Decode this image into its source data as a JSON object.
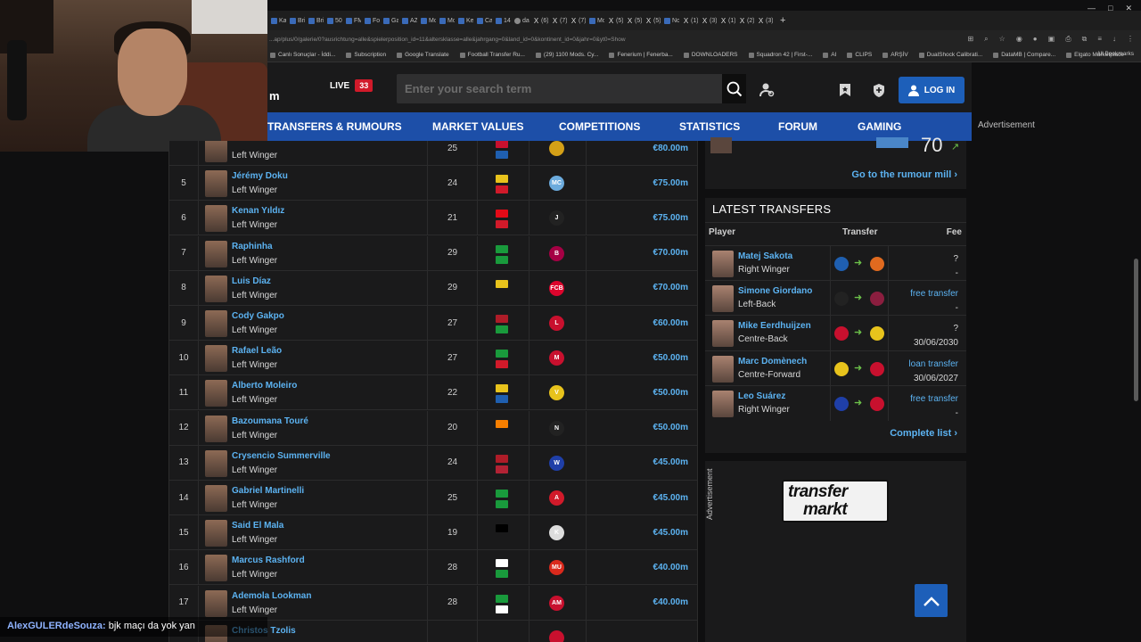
{
  "browser": {
    "tabs": [
      "Ka",
      "Bri",
      "Bri",
      "50",
      "FM",
      "Fo",
      "Gal",
      "AZ",
      "Mc",
      "Mc",
      "Ke",
      "Ca",
      "14",
      "da",
      "(6)",
      "(7)",
      "(7)",
      "Mc",
      "(5)",
      "(5)",
      "(5)",
      "No",
      "(1)",
      "(3)",
      "(1)",
      "(2)",
      "(3)"
    ],
    "url": "...ap/plus/0/galerie/0?ausrichtung=alle&spielerposition_id=11&altersklasse=alle&jahrgang=0&land_id=0&kontinent_id=0&jahr=0&yt0=Show",
    "bookmarks": [
      "Canlı Sonuçlar - İddi...",
      "Subscription",
      "Google Translate",
      "Football Transfer Ru...",
      "(29) 1100 Mods. Cy...",
      "Fenerium | Fenerba...",
      "DOWNLOADERS",
      "Squadron 42 | First-...",
      "AI",
      "CLIPS",
      "ARŞİV",
      "DualShock Calibrati...",
      "DataMB | Compare...",
      "Elgato Marketplace"
    ],
    "all_bookmarks": "All Bookmarks"
  },
  "header": {
    "logo_fragment": "m",
    "live_label": "LIVE",
    "live_count": "33",
    "search_placeholder": "Enter your search term",
    "login_label": "LOG IN"
  },
  "nav": [
    "TRANSFERS & RUMOURS",
    "MARKET VALUES",
    "COMPETITIONS",
    "STATISTICS",
    "FORUM",
    "GAMING"
  ],
  "advertisement": "Advertisement",
  "players": [
    {
      "rank": "",
      "name": "",
      "position": "Left Winger",
      "age": "25",
      "flags": [
        "#c8102e",
        "#1f5fb0"
      ],
      "club_color": "#d4a017",
      "club_abbr": "",
      "value": "€80.00m"
    },
    {
      "rank": "5",
      "name": "Jérémy Doku",
      "position": "Left Winger",
      "age": "24",
      "flags": [
        "#e8c31c",
        "#d11a2a"
      ],
      "club_color": "#6cabdd",
      "club_abbr": "MC",
      "value": "€75.00m"
    },
    {
      "rank": "6",
      "name": "Kenan Yıldız",
      "position": "Left Winger",
      "age": "21",
      "flags": [
        "#e30a17",
        "#d11a2a"
      ],
      "club_color": "#222222",
      "club_abbr": "J",
      "value": "€75.00m"
    },
    {
      "rank": "7",
      "name": "Raphinha",
      "position": "Left Winger",
      "age": "29",
      "flags": [
        "#199a3c",
        "#199a3c"
      ],
      "club_color": "#a50044",
      "club_abbr": "B",
      "value": "€70.00m"
    },
    {
      "rank": "8",
      "name": "Luis Díaz",
      "position": "Left Winger",
      "age": "29",
      "flags": [
        "#e8c31c"
      ],
      "club_color": "#dc052d",
      "club_abbr": "FCB",
      "value": "€70.00m"
    },
    {
      "rank": "9",
      "name": "Cody Gakpo",
      "position": "Left Winger",
      "age": "27",
      "flags": [
        "#ae1c28",
        "#199a3c"
      ],
      "club_color": "#c8102e",
      "club_abbr": "L",
      "value": "€60.00m"
    },
    {
      "rank": "10",
      "name": "Rafael Leão",
      "position": "Left Winger",
      "age": "27",
      "flags": [
        "#199a3c",
        "#d11a2a"
      ],
      "club_color": "#c8102e",
      "club_abbr": "M",
      "value": "€50.00m"
    },
    {
      "rank": "11",
      "name": "Alberto Moleiro",
      "position": "Left Winger",
      "age": "22",
      "flags": [
        "#e8c31c",
        "#1f5fb0"
      ],
      "club_color": "#e8c31c",
      "club_abbr": "V",
      "value": "€50.00m"
    },
    {
      "rank": "12",
      "name": "Bazoumana Touré",
      "position": "Left Winger",
      "age": "20",
      "flags": [
        "#f77f00"
      ],
      "club_color": "#222222",
      "club_abbr": "N",
      "value": "€50.00m"
    },
    {
      "rank": "13",
      "name": "Crysencio Summerville",
      "position": "Left Winger",
      "age": "24",
      "flags": [
        "#ae1c28",
        "#b22234"
      ],
      "club_color": "#1f3fa8",
      "club_abbr": "W",
      "value": "€45.00m"
    },
    {
      "rank": "14",
      "name": "Gabriel Martinelli",
      "position": "Left Winger",
      "age": "25",
      "flags": [
        "#199a3c",
        "#199a3c"
      ],
      "club_color": "#d11a2a",
      "club_abbr": "A",
      "value": "€45.00m"
    },
    {
      "rank": "15",
      "name": "Said El Mala",
      "position": "Left Winger",
      "age": "19",
      "flags": [
        "#000000"
      ],
      "club_color": "#dddddd",
      "club_abbr": "K",
      "value": "€45.00m"
    },
    {
      "rank": "16",
      "name": "Marcus Rashford",
      "position": "Left Winger",
      "age": "28",
      "flags": [
        "#ffffff",
        "#199a3c"
      ],
      "club_color": "#da291c",
      "club_abbr": "MU",
      "value": "€40.00m"
    },
    {
      "rank": "17",
      "name": "Ademola Lookman",
      "position": "Left Winger",
      "age": "28",
      "flags": [
        "#199a3c",
        "#ffffff"
      ],
      "club_color": "#c8102e",
      "club_abbr": "AM",
      "value": "€40.00m"
    },
    {
      "rank": "",
      "name": "Christos Tzolis",
      "position": "",
      "age": "",
      "flags": [],
      "club_color": "#c8102e",
      "club_abbr": "",
      "value": ""
    }
  ],
  "rumour": {
    "link_label": "Go to the rumour mill",
    "value_fragment": "70"
  },
  "latest_transfers": {
    "title": "LATEST TRANSFERS",
    "col_player": "Player",
    "col_transfer": "Transfer",
    "col_fee": "Fee",
    "rows": [
      {
        "name": "Matej Sakota",
        "position": "Right Winger",
        "from_color": "#1f5fb0",
        "to_color": "#e06a1f",
        "fee": "?",
        "fee2": "-",
        "fee_blue": false
      },
      {
        "name": "Simone Giordano",
        "position": "Left-Back",
        "from_color": "#222222",
        "to_color": "#8b1e3f",
        "fee": "free transfer",
        "fee2": "-",
        "fee_blue": true
      },
      {
        "name": "Mike Eerdhuijzen",
        "position": "Centre-Back",
        "from_color": "#c8102e",
        "to_color": "#e8c31c",
        "fee": "?",
        "fee2": "30/06/2030",
        "fee_blue": false
      },
      {
        "name": "Marc Domènech",
        "position": "Centre-Forward",
        "from_color": "#e8c31c",
        "to_color": "#c8102e",
        "fee": "loan transfer",
        "fee2": "30/06/2027",
        "fee_blue": true
      },
      {
        "name": "Leo Suárez",
        "position": "Right Winger",
        "from_color": "#1f3fa8",
        "to_color": "#c8102e",
        "fee": "free transfer",
        "fee2": "-",
        "fee_blue": true
      }
    ],
    "complete_label": "Complete list"
  },
  "ad_logo": {
    "line1": "transfer",
    "line2": "markt"
  },
  "chat": {
    "user": "AlexGULERdeSouza:",
    "message": "bjk maçı da yok yan"
  }
}
